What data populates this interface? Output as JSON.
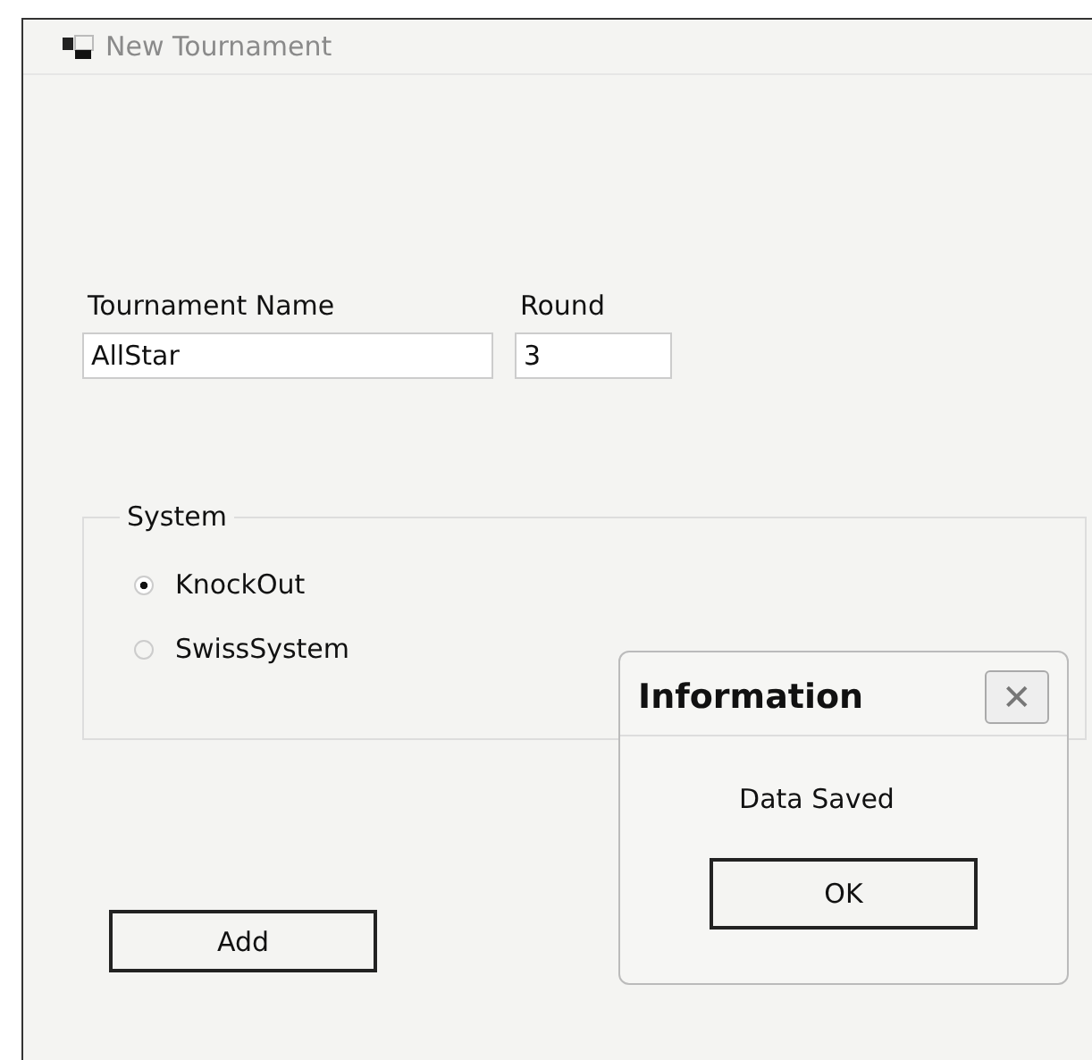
{
  "window": {
    "title": "New Tournament"
  },
  "fields": [
    {
      "label": "Tournament Name",
      "value": "AllStar"
    },
    {
      "label": "Round",
      "value": "3"
    }
  ],
  "system": {
    "title": "System",
    "options": [
      {
        "label": "KnockOut",
        "selected": true
      },
      {
        "label": "SwissSystem",
        "selected": false
      }
    ]
  },
  "add_button": "Add",
  "message_box": {
    "title": "Information",
    "close": "✕",
    "message": "Data Saved",
    "button": "OK"
  }
}
